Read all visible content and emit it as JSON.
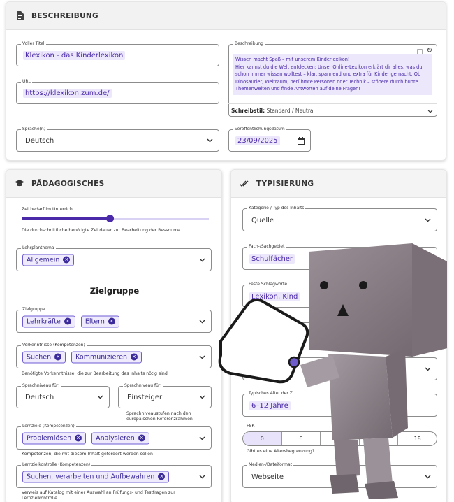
{
  "beschreibung_card": {
    "title": "BESCHREIBUNG",
    "voller_titel": {
      "label": "Voller Titel",
      "value": "Klexikon - das Kinderlexikon"
    },
    "url": {
      "label": "URL",
      "value": "https://klexikon.zum.de/"
    },
    "sprache": {
      "label": "Sprache(n)",
      "value": "Deutsch"
    },
    "beschreibung": {
      "label": "Beschreibung",
      "text_lines": [
        "Wissen macht Spaß – mit unserem Kinderlexikon!",
        "Hier kannst du die Welt entdecken: Unser Online-Lexikon erklärt dir alles, was du",
        "schon immer wissen wolltest – klar, spannend und extra für Kinder gemacht. Ob",
        "Dinosaurier, Weltraum, berühmte Personen oder Technik – stöbere durch bunte",
        "Themenwelten und finde Antworten auf deine Fragen!"
      ],
      "style_label": "Schreibstil:",
      "style_value": "Standard / Neutral"
    },
    "datum": {
      "label": "Veröffentlichungsdatum",
      "value": "23/09/2025"
    }
  },
  "paed_card": {
    "title": "PÄDAGOGISCHES",
    "zeitbedarf": {
      "label": "Zeitbedarf im Unterricht",
      "help": "Die durchschnittliche benötigte Zeitdauer zur Bearbeitung der Ressource",
      "fraction": 0.47
    },
    "lehrplanthema": {
      "label": "Lehrplanthema",
      "chips": [
        "Allgemein"
      ]
    },
    "zielgruppe_heading": "Zielgruppe",
    "zielgruppe": {
      "label": "Zielgruppe",
      "chips": [
        "Lehrkräfte",
        "Eltern"
      ]
    },
    "vorkenntnisse": {
      "label": "Vorkenntnisse (Kompetenzen)",
      "chips": [
        "Suchen",
        "Kommunizieren"
      ],
      "help": "Benötigte Vorkenntnisse, die zur Bearbeitung des Inhalts nötig sind"
    },
    "sprachniveau1": {
      "label": "Sprachniveau für:",
      "value": "Deutsch"
    },
    "sprachniveau2": {
      "label": "Sprachniveau für:",
      "value": "Einsteiger",
      "help1": "Sprachniveaustufen nach den",
      "help2": "europäischen Referenzrahmen"
    },
    "lernziele": {
      "label": "Lernziele (Kompetenzen)",
      "chips": [
        "Problemlösen",
        "Analysieren"
      ],
      "help": "Kompetenzen, die mit diesem Inhalt gefördert werden sollen"
    },
    "lernkontrolle": {
      "label": "Lernzielkontrolle (Kompetenzen)",
      "chips": [
        "Suchen, verarbeiten und Aufbewahren"
      ],
      "help1": "Verweis auf Katalog mit einer Auswahl an Prüfungs- und Testfragen zur",
      "help2": "Lernzielkontrolle"
    }
  },
  "typ_card": {
    "title": "TYPISIERUNG",
    "kategorie": {
      "label": "Kategorie / Typ des Inhalts",
      "value": "Quelle"
    },
    "fach": {
      "label": "Fach-/Sachgebiet",
      "chip": "Schulfächer"
    },
    "schlagworte": {
      "label": "Feste Schlagworte",
      "chip": "Lexikon, Kind"
    },
    "alter": {
      "label": "Typisches Alter der Z",
      "value": "6–12 Jahre"
    },
    "fsk": {
      "label": "FSK",
      "options": [
        "0",
        "6",
        "12",
        "16",
        "18"
      ],
      "selected": "0",
      "help": "Gibt es eine Altersbegrenzung?"
    },
    "medien": {
      "label": "Medien-/Dateiformat",
      "value": "Webseite"
    }
  },
  "colors": {
    "accent": "#4a2aa8",
    "chip_bg": "#efeafc",
    "header_bg": "#f2f2f2",
    "figure": "#8a7f86"
  },
  "icons": [
    "document-icon",
    "graduation-cap-icon",
    "check-marks-icon",
    "chevron-down-icon",
    "calendar-icon",
    "refresh-icon",
    "copy-icon",
    "close-chip-icon",
    "tag-icon"
  ]
}
